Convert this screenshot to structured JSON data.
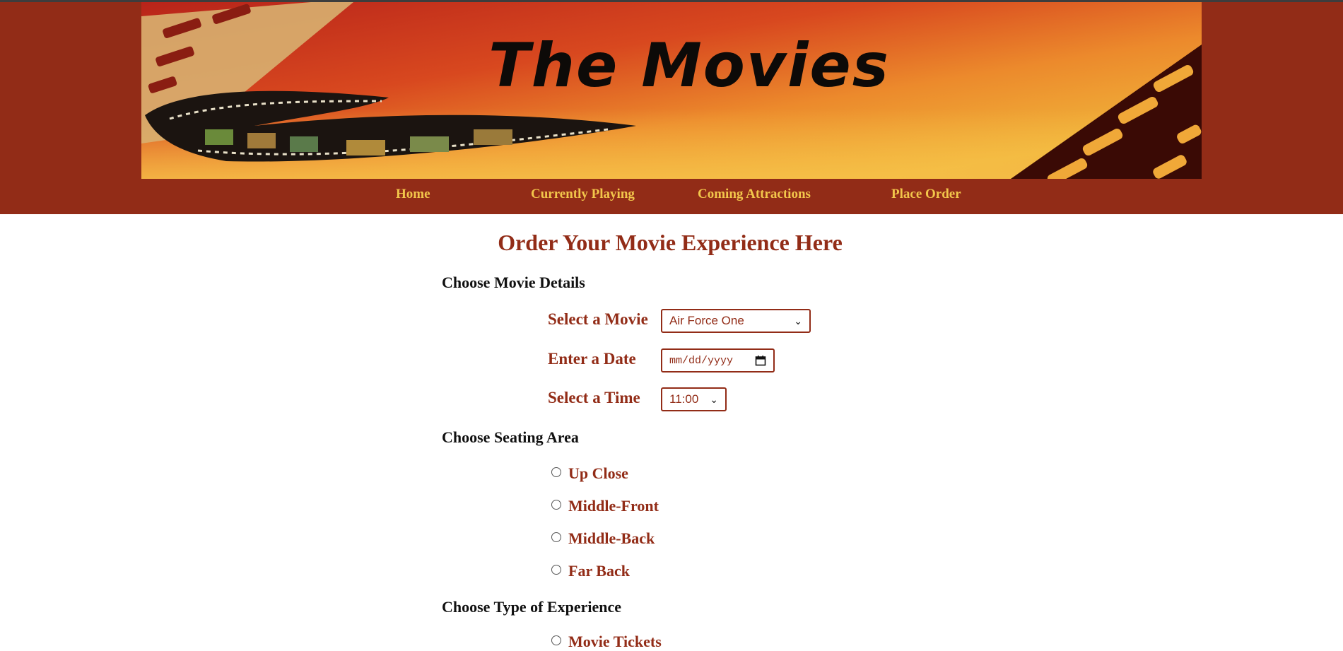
{
  "banner": {
    "title": "The Movies"
  },
  "nav": {
    "items": [
      {
        "label": "Home"
      },
      {
        "label": "Currently Playing"
      },
      {
        "label": "Coming Attractions"
      },
      {
        "label": "Place Order"
      }
    ]
  },
  "page": {
    "heading": "Order Your Movie Experience Here"
  },
  "movie_details": {
    "heading": "Choose Movie Details",
    "movie_label": "Select a Movie",
    "movie_value": "Air Force One",
    "date_label": "Enter a Date",
    "date_placeholder": "mm/dd/yyyy",
    "time_label": "Select a Time",
    "time_value": "11:00"
  },
  "seating": {
    "heading": "Choose Seating Area",
    "options": [
      "Up Close",
      "Middle-Front",
      "Middle-Back",
      "Far Back"
    ]
  },
  "experience": {
    "heading": "Choose Type of Experience",
    "options": [
      "Movie Tickets"
    ]
  },
  "colors": {
    "brand": "#922c17",
    "nav_text": "#f2c64b"
  },
  "icons": {
    "select": "chevron-down-icon",
    "date": "calendar-icon",
    "radio": "radio-icon"
  }
}
